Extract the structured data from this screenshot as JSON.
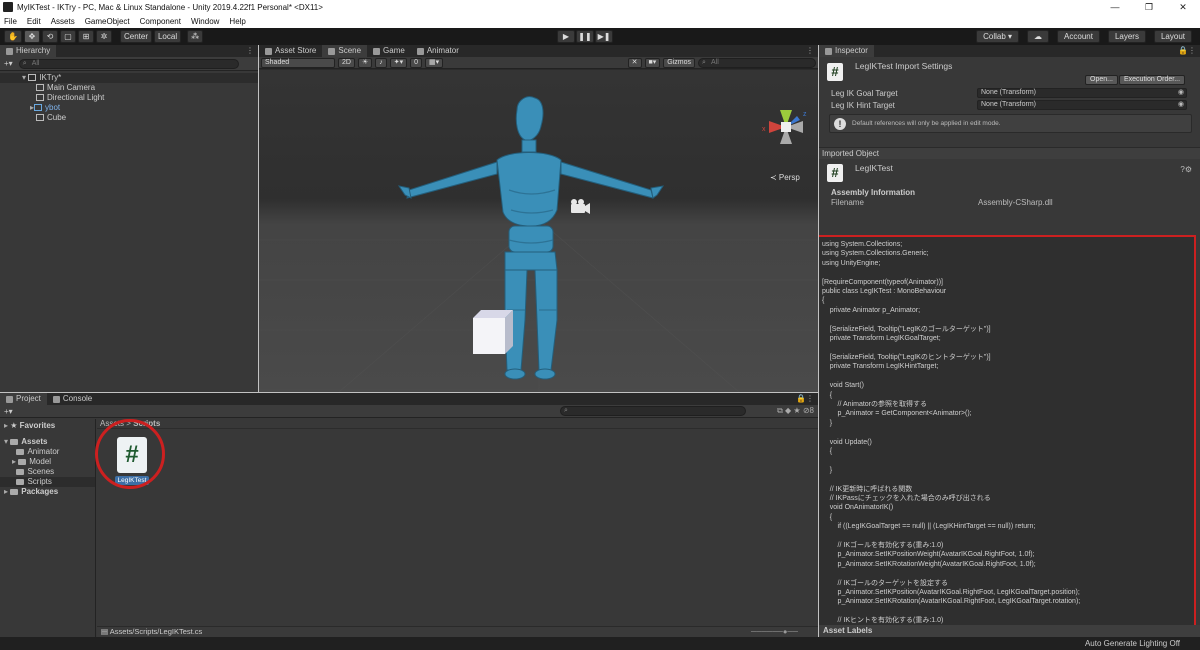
{
  "window": {
    "title": "MyIKTest - IKTry - PC, Mac & Linux Standalone - Unity 2019.4.22f1 Personal* <DX11>",
    "controls": [
      "—",
      "❐",
      "✕"
    ]
  },
  "menu": [
    "File",
    "Edit",
    "Assets",
    "GameObject",
    "Component",
    "Window",
    "Help"
  ],
  "toolbar": {
    "tools": [
      "✋",
      "✥",
      "⟲",
      "▢",
      "⊞",
      "✲"
    ],
    "center_label": "Center",
    "local_label": "Local",
    "snap_icon": "⁂",
    "play_icons": [
      "▶",
      "❚❚",
      "▶❚"
    ],
    "collab_label": "Collab ▾",
    "cloud_icon": "☁",
    "account_label": "Account",
    "layers_label": "Layers",
    "layout_label": "Layout"
  },
  "hierarchy": {
    "tab_label": "Hierarchy",
    "search_placeholder": "All",
    "scene_name": "IKTry*",
    "items": [
      "Main Camera",
      "Directional Light",
      "ybot",
      "Cube"
    ]
  },
  "scene": {
    "tabs": [
      "Asset Store",
      "Scene",
      "Game",
      "Animator"
    ],
    "shading": "Shaded",
    "mode_2d": "2D",
    "fx_count": "0",
    "gizmos_label": "Gizmos",
    "search_placeholder": "All",
    "persp_label": "≺ Persp",
    "axis_x": "x",
    "axis_z": "z"
  },
  "inspector": {
    "tab_label": "Inspector",
    "title": "LegIKTest Import Settings",
    "open_label": "Open...",
    "exec_order_label": "Execution Order...",
    "props": [
      {
        "label": "Leg IK Goal Target",
        "value": "None (Transform)"
      },
      {
        "label": "Leg IK Hint Target",
        "value": "None (Transform)"
      }
    ],
    "info_text": "Default references will only be applied in edit mode.",
    "imported_object_label": "Imported Object",
    "object_name": "LegIKTest",
    "assembly_info_label": "Assembly Information",
    "filename_label": "Filename",
    "filename_value": "Assembly-CSharp.dll",
    "code": "using System.Collections;\nusing System.Collections.Generic;\nusing UnityEngine;\n\n[RequireComponent(typeof(Animator))]\npublic class LegIKTest : MonoBehaviour\n{\n    private Animator p_Animator;\n\n    [SerializeField, Tooltip(\"LegIKのゴールターゲット\")]\n    private Transform LegIKGoalTarget;\n\n    [SerializeField, Tooltip(\"LegIKのヒントターゲット\")]\n    private Transform LegIKHintTarget;\n\n    void Start()\n    {\n        // Animatorの参照を取得する\n        p_Animator = GetComponent<Animator>();\n    }\n\n    void Update()\n    {\n\n    }\n\n    // IK更新時に呼ばれる関数\n    // IKPassにチェックを入れた場合のみ呼び出される\n    void OnAnimatorIK()\n    {\n        if ((LegIKGoalTarget == null) || (LegIKHintTarget == null)) return;\n\n        // IKゴールを有効化する(重み:1.0)\n        p_Animator.SetIKPositionWeight(AvatarIKGoal.RightFoot, 1.0f);\n        p_Animator.SetIKRotationWeight(AvatarIKGoal.RightFoot, 1.0f);\n\n        // IKゴールのターゲットを設定する\n        p_Animator.SetIKPosition(AvatarIKGoal.RightFoot, LegIKGoalTarget.position);\n        p_Animator.SetIKRotation(AvatarIKGoal.RightFoot, LegIKGoalTarget.rotation);\n\n        // IKヒントを有効化する(重み:1.0)",
    "asset_labels": "Asset Labels"
  },
  "project": {
    "tabs": [
      "Project",
      "Console"
    ],
    "tree": [
      {
        "label": "Favorites",
        "level": 0
      },
      {
        "label": "Assets",
        "level": 0
      },
      {
        "label": "Animator",
        "level": 1
      },
      {
        "label": "Model",
        "level": 1
      },
      {
        "label": "Scenes",
        "level": 1
      },
      {
        "label": "Scripts",
        "level": 1
      },
      {
        "label": "Packages",
        "level": 0
      }
    ],
    "breadcrumb_root": "Assets",
    "breadcrumb_sep": ">",
    "breadcrumb_leaf": "Scripts",
    "asset_name": "LegIKTest",
    "hidden_count": "8",
    "path": "Assets/Scripts/LegIKTest.cs"
  },
  "status": {
    "text": "Auto Generate Lighting Off"
  },
  "colors": {
    "highlight_red": "#cc2020",
    "model_blue": "#3a8fb8",
    "selection_blue": "#3d6fa6"
  }
}
